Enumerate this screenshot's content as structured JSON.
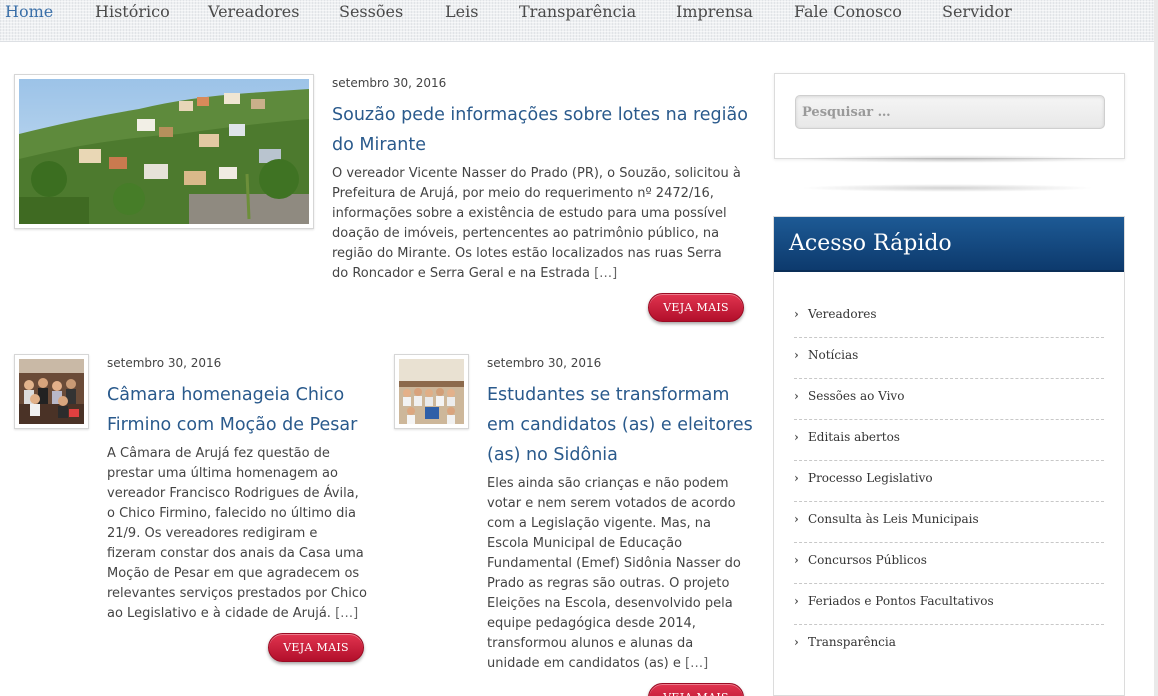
{
  "nav": {
    "items": [
      "Home",
      "Histórico",
      "Vereadores",
      "Sessões",
      "Leis",
      "Transparência",
      "Imprensa",
      "Fale Conosco",
      "Servidor"
    ]
  },
  "posts": [
    {
      "date": "setembro 30, 2016",
      "title": "Souzão pede informações sobre lotes na região do Mirante",
      "excerpt": "O vereador Vicente Nasser do Prado (PR), o Souzão, solicitou à Prefeitura de Arujá, por meio do requerimento nº 2472/16, informações sobre a existência de estudo para uma possível doação de imóveis,  pertencentes ao patrimônio público, na região do Mirante. Os lotes estão localizados nas ruas Serra do Roncador e Serra Geral e na Estrada ",
      "more": "[…]",
      "button": "VEJA MAIS"
    },
    {
      "date": "setembro 30, 2016",
      "title": "Câmara homenageia Chico Firmino com Moção de Pesar",
      "excerpt": "A Câmara de Arujá fez questão de prestar uma última homenagem ao vereador Francisco Rodrigues de Ávila, o Chico Firmino, falecido no último dia 21/9. Os vereadores redigiram e fizeram constar dos anais da Casa uma Moção de Pesar em que agradecem os relevantes serviços prestados por Chico ao Legislativo e à cidade de Arujá. ",
      "more": "[…]",
      "button": "VEJA MAIS"
    },
    {
      "date": "setembro 30, 2016",
      "title": "Estudantes se transformam em candidatos (as) e eleitores (as) no Sidônia",
      "excerpt": "Eles ainda são crianças e não podem votar e nem serem votados de acordo com a Legislação vigente. Mas, na Escola Municipal de Educação Fundamental (Emef) Sidônia Nasser do Prado as regras são outras. O projeto Eleições na Escola, desenvolvido pela equipe pedagógica desde 2014, transformou alunos e alunas da unidade em candidatos (as) e ",
      "more": "[…]",
      "button": "VEJA MAIS"
    }
  ],
  "search": {
    "placeholder": "Pesquisar …"
  },
  "quick_access": {
    "title": "Acesso Rápido",
    "items": [
      "Vereadores",
      "Notícias",
      "Sessões ao Vivo",
      "Editais abertos",
      "Processo Legislativo",
      "Consulta às Leis Municipais",
      "Concursos Públicos",
      "Feriados e Pontos Facultativos",
      "Transparência"
    ]
  },
  "colors": {
    "nav_active": "#3a6fa8",
    "title_link": "#2a5a8c",
    "button": "#c41633",
    "panel_header": "#11477f"
  }
}
